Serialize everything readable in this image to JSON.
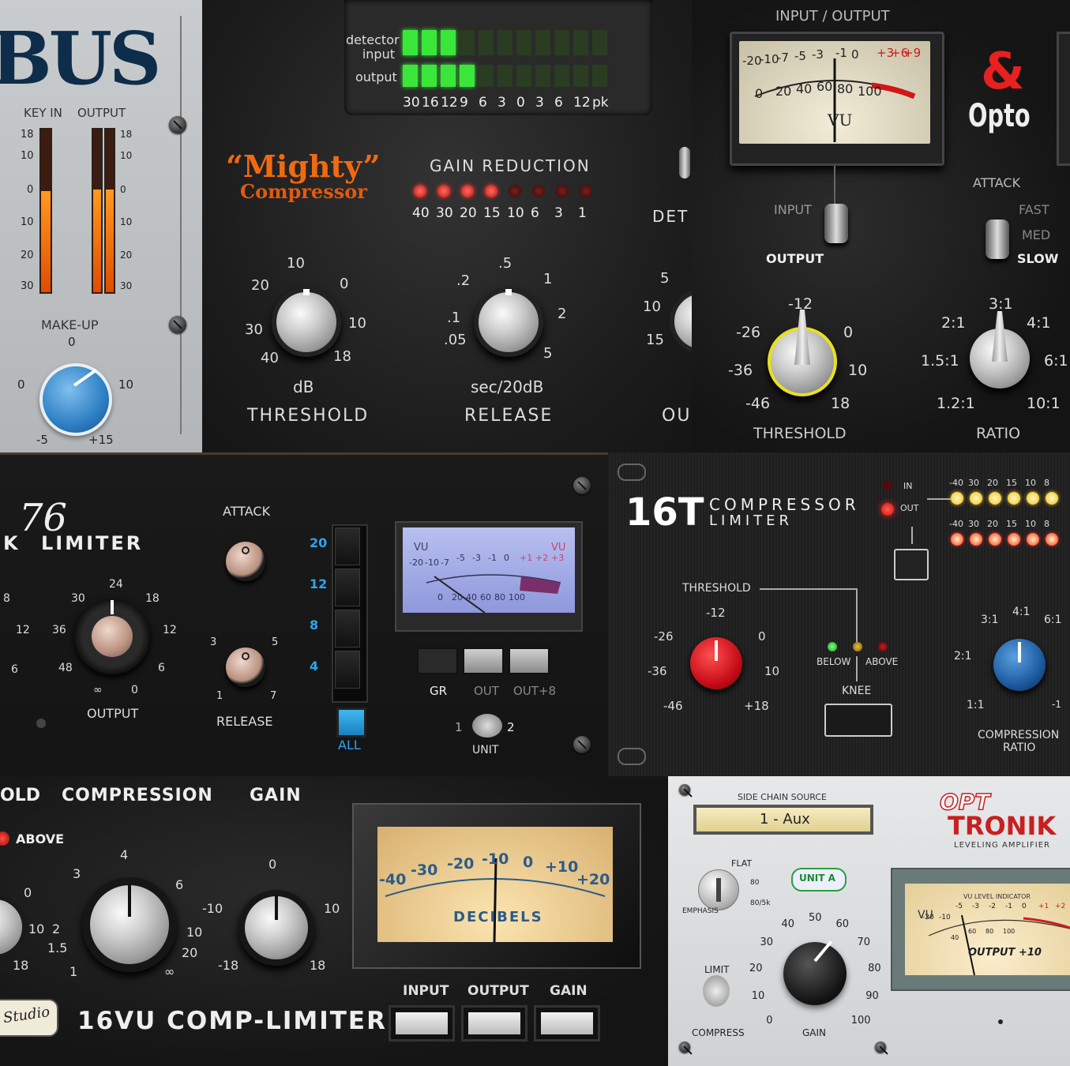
{
  "bus": {
    "logo": "BUS",
    "key_in_label": "KEY IN",
    "output_label": "OUTPUT",
    "meter_scale_left": [
      "18",
      "10",
      "0",
      "10",
      "20",
      "30"
    ],
    "meter_scale_right": [
      "18",
      "10",
      "0",
      "10",
      "20",
      "30"
    ],
    "makeup_label": "MAKE-UP",
    "makeup_top": "0",
    "makeup_left": "0",
    "makeup_right": "10",
    "makeup_min": "-5",
    "makeup_max": "+15"
  },
  "mighty": {
    "detector_input_label": "detector\ninput",
    "output_label": "output",
    "meter_scale": [
      "30",
      "16",
      "12",
      "9",
      "6",
      "3",
      "0",
      "3",
      "6",
      "12",
      "pk"
    ],
    "detector_lit": 3,
    "output_lit": 4,
    "logo_line1": "“Mighty”",
    "logo_line2": "Compressor",
    "gain_reduction_label": "GAIN REDUCTION",
    "gr_values": [
      "40",
      "30",
      "20",
      "15",
      "10",
      "6",
      "3",
      "1"
    ],
    "gr_lit": 4,
    "threshold_scale": [
      "10",
      "20",
      "0",
      "30",
      "10",
      "40",
      "18"
    ],
    "threshold_unit": "dB",
    "threshold_label": "THRESHOLD",
    "release_scale": [
      ".5",
      ".2",
      "1",
      ".1",
      "2",
      ".05",
      "5"
    ],
    "release_unit": "sec/20dB",
    "release_label": "RELEASE",
    "det_label": "DET",
    "out_label": "OU",
    "extra_scale": [
      "5",
      "10",
      "15"
    ]
  },
  "opto": {
    "io_label": "INPUT / OUTPUT",
    "vu_top_scale": [
      "-20",
      "-10",
      "-7",
      "-5",
      "-3",
      "-1",
      "0",
      "+3",
      "+6",
      "+9"
    ],
    "vu_bottom_scale": [
      "0",
      "20",
      "40",
      "60",
      "80",
      "100"
    ],
    "vu_label": "VU",
    "logo_amp": "&",
    "logo_word": "Opto",
    "input_label": "INPUT",
    "output_label": "OUTPUT",
    "attack_label": "ATTACK",
    "attack_fast": "FAST",
    "attack_med": "MED",
    "attack_slow": "SLOW",
    "threshold_scale": [
      "-12",
      "-26",
      "0",
      "-36",
      "10",
      "-46",
      "18"
    ],
    "threshold_label": "THRESHOLD",
    "ratio_scale": [
      "3:1",
      "2:1",
      "4:1",
      "1.5:1",
      "6:1",
      "1.2:1",
      "10:1"
    ],
    "ratio_label": "RATIO"
  },
  "limiter76": {
    "logo_k": "K",
    "logo_76": "76",
    "logo_word": "LIMITER",
    "output_scale": [
      "24",
      "30",
      "18",
      "36",
      "12",
      "48",
      "6",
      "∞",
      "0"
    ],
    "output_label": "OUTPUT",
    "input_partial_scale": [
      "8",
      "12",
      "6"
    ],
    "attack_label": "ATTACK",
    "release_scale": [
      "3",
      "5",
      "1",
      "7"
    ],
    "release_label": "RELEASE",
    "ratio_buttons": [
      "20",
      "12",
      "8",
      "4"
    ],
    "all_label": "ALL",
    "vu_left": "VU",
    "vu_right": "VU",
    "vu_top_scale": [
      "-20",
      "-10",
      "-7",
      "-5",
      "-3",
      "-1",
      "0",
      "+1",
      "+2",
      "+3"
    ],
    "vu_bottom_scale": [
      "0",
      "20",
      "40",
      "60",
      "80",
      "100"
    ],
    "meter_buttons": [
      "GR",
      "OUT",
      "OUT+8"
    ],
    "unit_1": "1",
    "unit_2": "2",
    "unit_label": "UNIT"
  },
  "t16": {
    "logo_num": "16T",
    "logo_line1": "COMPRESSOR",
    "logo_line2": "LIMITER",
    "in_label": "IN",
    "out_label": "OUT",
    "led_scale_top": [
      "-40",
      "30",
      "20",
      "15",
      "10",
      "8"
    ],
    "led_scale_bottom": [
      "-40",
      "30",
      "20",
      "15",
      "10",
      "8"
    ],
    "threshold_label": "THRESHOLD",
    "threshold_scale": [
      "-12",
      "-26",
      "0",
      "-36",
      "10",
      "-46",
      "+18"
    ],
    "below_label": "BELOW",
    "above_label": "ABOVE",
    "knee_label": "KNEE",
    "ratio_scale": [
      "4:1",
      "3:1",
      "6:1",
      "2:1",
      "1:1",
      "-1"
    ],
    "ratio_label_1": "COMPRESSION",
    "ratio_label_2": "RATIO"
  },
  "vu16": {
    "old_label": "OLD",
    "compression_label": "COMPRESSION",
    "gain_label": "GAIN",
    "above_label": "ABOVE",
    "left_partial_scale": [
      "0",
      "10",
      "18"
    ],
    "compression_scale": [
      "4",
      "3",
      "6",
      "2",
      "10",
      "1.5",
      "20",
      "1",
      "∞"
    ],
    "gain_scale": [
      "0",
      "-10",
      "10",
      "-18",
      "18"
    ],
    "vu_scale": [
      "-40",
      "-30",
      "-20",
      "-10",
      "0",
      "+10",
      "+20"
    ],
    "vu_word": "DECIBELS",
    "input_label": "INPUT",
    "output_label": "OUTPUT",
    "gain_btn_label": "GAIN",
    "studio_badge": "Studio",
    "product_name": "16VU COMP-LIMITER"
  },
  "optronik": {
    "side_chain_label": "SIDE CHAIN SOURCE",
    "side_chain_value": "1 - Aux",
    "logo_opt": "OPT",
    "logo_tronik": "TRONIK",
    "logo_sub": "LEVELING AMPLIFIER",
    "flat_label": "FLAT",
    "hz80_label": "80",
    "hz80_5k_label": "80/5k",
    "emphasis_label": "EMPHASIS",
    "unit_badge": "UNIT A",
    "limit_label": "LIMIT",
    "compress_label": "COMPRESS",
    "gain_scale": [
      "0",
      "10",
      "20",
      "30",
      "40",
      "50",
      "60",
      "70",
      "80",
      "90",
      "100"
    ],
    "gain_label": "GAIN",
    "vu_title": "VU LEVEL INDICATOR",
    "vu_label": "VU",
    "vu_scale": [
      "-20",
      "-10",
      "-5",
      "-3",
      "-2",
      "-1",
      "0",
      "+1",
      "+2"
    ],
    "vu_bottom": [
      "40",
      "60",
      "80",
      "100"
    ],
    "vu_mode": "OUTPUT +10"
  },
  "colors": {
    "led_green": "#3ae63a",
    "led_red": "#ff2a1a",
    "accent_blue": "#2e86d6",
    "mighty_orange": "#f06a10"
  }
}
